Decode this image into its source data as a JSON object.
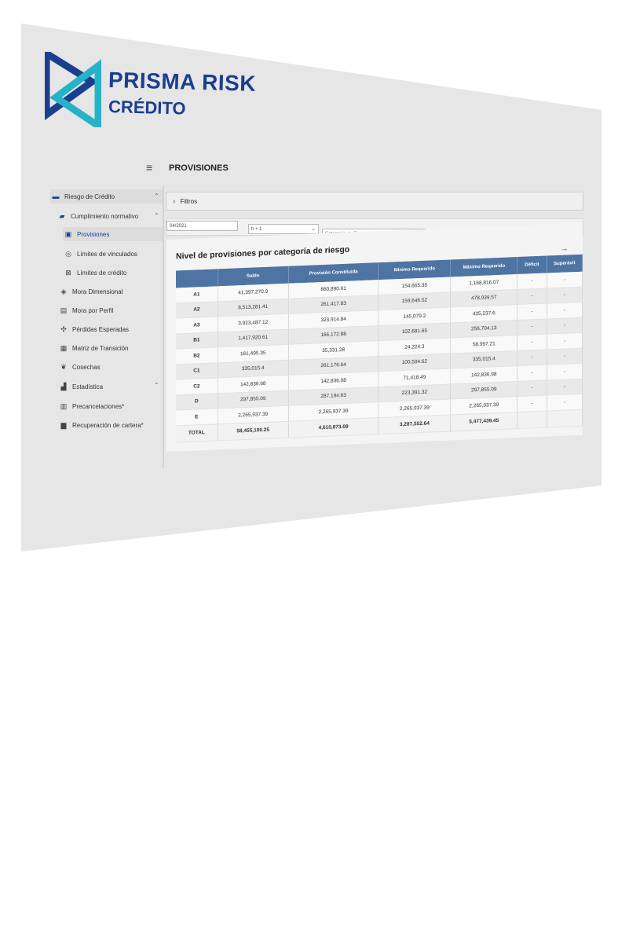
{
  "brand": {
    "line1": "PRISMA RISK",
    "line2": "CRÉDITO",
    "colors": {
      "primary": "#1b3f8f",
      "accent": "#27b3c7"
    }
  },
  "header": {
    "menu_icon": "hamburger-icon",
    "menu_glyph": "≡",
    "title": "PROVISIONES"
  },
  "sidebar": {
    "items": [
      {
        "label": "Riesgo de Crédito",
        "icon": "credit-card-icon",
        "glyph": "▬"
      },
      {
        "label": "Cumplimiento normativo",
        "icon": "book-icon",
        "glyph": "▰"
      },
      {
        "label": "Provisiones",
        "icon": "provisions-icon",
        "glyph": "▣"
      },
      {
        "label": "Límites de vinculados",
        "icon": "link-eye-icon",
        "glyph": "◎"
      },
      {
        "label": "Límites de crédito",
        "icon": "credit-limit-icon",
        "glyph": "⊠"
      },
      {
        "label": "Mora Dimensional",
        "icon": "cube-icon",
        "glyph": "◈"
      },
      {
        "label": "Mora por Perfil",
        "icon": "profile-doc-icon",
        "glyph": "▤"
      },
      {
        "label": "Pérdidas Esperadas",
        "icon": "loss-icon",
        "glyph": "✣"
      },
      {
        "label": "Matriz de Transición",
        "icon": "matrix-icon",
        "glyph": "▦"
      },
      {
        "label": "Cosechas",
        "icon": "harvest-icon",
        "glyph": "❦"
      },
      {
        "label": "Estadística",
        "icon": "stats-icon",
        "glyph": "▟"
      },
      {
        "label": "Precancelaciones*",
        "icon": "calendar-icon",
        "glyph": "▥"
      },
      {
        "label": "Recuperación de cartera*",
        "icon": "folder-icon",
        "glyph": "▆"
      }
    ]
  },
  "filters": {
    "toggle_label": "Filtros",
    "period": "04/2021",
    "horizon": "h + 1",
    "category_placeholder": "Categoría de Riesgo"
  },
  "report": {
    "title": "Nivel de provisiones por categoría de riesgo",
    "export_glyph": "→",
    "columns": [
      "",
      "Saldo",
      "Provisión Constituida",
      "Mínimo Requerido",
      "Máximo Requerido",
      "Déficit",
      "Superávit"
    ],
    "rows": [
      {
        "cat": "A1",
        "saldo": "41,397,270.9",
        "prov": "860,890.61",
        "min": "154,665.35",
        "max": "1,168,816.07",
        "def": "-",
        "sup": "-"
      },
      {
        "cat": "A2",
        "saldo": "8,513,281.41",
        "prov": "261,417.83",
        "min": "159,646.52",
        "max": "478,939.57",
        "def": "-",
        "sup": "-"
      },
      {
        "cat": "A3",
        "saldo": "3,923,487.12",
        "prov": "323,914.84",
        "min": "145,079.2",
        "max": "435,237.6",
        "def": "-",
        "sup": "-"
      },
      {
        "cat": "B1",
        "saldo": "1,417,920.61",
        "prov": "166,172.88",
        "min": "102,681.65",
        "max": "256,704.13",
        "def": "-",
        "sup": "-"
      },
      {
        "cat": "B2",
        "saldo": "161,495.35",
        "prov": "35,331.28",
        "min": "24,224.3",
        "max": "58,997.21",
        "def": "-",
        "sup": "-"
      },
      {
        "cat": "C1",
        "saldo": "335,015.4",
        "prov": "261,176.64",
        "min": "100,504.62",
        "max": "335,015.4",
        "def": "-",
        "sup": "-"
      },
      {
        "cat": "C2",
        "saldo": "142,836.98",
        "prov": "142,836.98",
        "min": "71,418.49",
        "max": "142,836.98",
        "def": "-",
        "sup": "-"
      },
      {
        "cat": "D",
        "saldo": "297,855.09",
        "prov": "287,194.63",
        "min": "223,391.32",
        "max": "297,855.09",
        "def": "-",
        "sup": "-"
      },
      {
        "cat": "E",
        "saldo": "2,265,937.39",
        "prov": "2,265,937.39",
        "min": "2,265,937.39",
        "max": "2,265,937.39",
        "def": "-",
        "sup": "-"
      }
    ],
    "total": {
      "cat": "TOTAL",
      "saldo": "58,455,100.25",
      "prov": "4,610,873.08",
      "min": "3,287,552.64",
      "max": "5,477,439.45",
      "def": "",
      "sup": ""
    },
    "header_color": "#4d74a3"
  }
}
